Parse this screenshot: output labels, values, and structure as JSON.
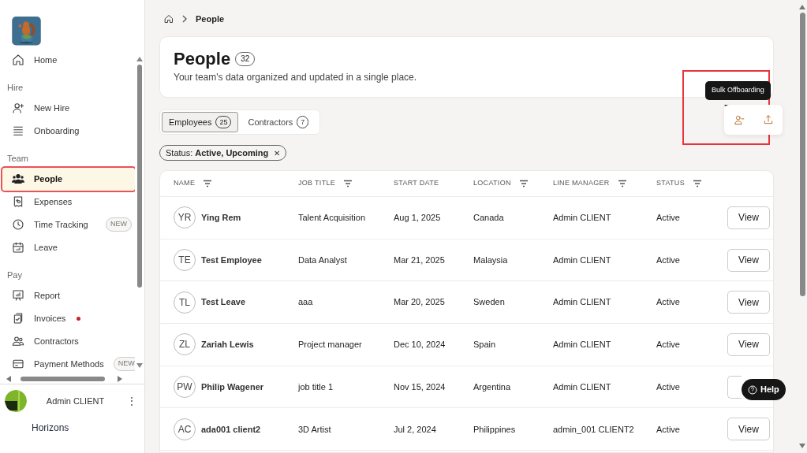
{
  "sidebar": {
    "sections": [
      {
        "items": [
          {
            "label": "Home",
            "selected": false,
            "highlighted": false
          }
        ]
      },
      {
        "title": "Hire",
        "items": [
          {
            "label": "New Hire",
            "selected": false,
            "highlighted": false
          },
          {
            "label": "Onboarding",
            "selected": false,
            "highlighted": false
          }
        ]
      },
      {
        "title": "Team",
        "items": [
          {
            "label": "People",
            "selected": true,
            "highlighted": true
          },
          {
            "label": "Expenses",
            "selected": false,
            "highlighted": false
          },
          {
            "label": "Time Tracking",
            "badge": "NEW",
            "selected": false,
            "highlighted": false
          },
          {
            "label": "Leave",
            "selected": false,
            "highlighted": false
          }
        ]
      },
      {
        "title": "Pay",
        "items": [
          {
            "label": "Report",
            "selected": false,
            "highlighted": false
          },
          {
            "label": "Invoices",
            "notification": true,
            "selected": false,
            "highlighted": false
          },
          {
            "label": "Contractors",
            "selected": false,
            "highlighted": false
          },
          {
            "label": "Payment Methods",
            "badge": "NEW",
            "selected": false,
            "highlighted": false
          }
        ]
      }
    ],
    "user": {
      "name": "Admin CLIENT",
      "menu": "⋮"
    },
    "company": "Horizons"
  },
  "breadcrumb": {
    "current": "People"
  },
  "header": {
    "title": "People",
    "count": "32",
    "subtitle": "Your team's data organized and updated in a single place."
  },
  "actions": {
    "tooltip": "Bulk Offboarding",
    "highlighted": true
  },
  "tabs": [
    {
      "label": "Employees",
      "count": "25",
      "selected": true
    },
    {
      "label": "Contractors",
      "count": "7",
      "selected": false
    }
  ],
  "filter": {
    "label": "Status:",
    "value": "Active, Upcoming",
    "close": "✕"
  },
  "table": {
    "columns": [
      {
        "label": "NAME",
        "filter": true
      },
      {
        "label": "JOB TITLE",
        "filter": true
      },
      {
        "label": "START DATE",
        "filter": false
      },
      {
        "label": "LOCATION",
        "filter": true
      },
      {
        "label": "LINE MANAGER",
        "filter": true
      },
      {
        "label": "STATUS",
        "filter": true
      }
    ],
    "rows": [
      {
        "initials": "YR",
        "name": "Ying Rem",
        "job": "Talent Acquisition",
        "start": "Aug 1, 2025",
        "location": "Canada",
        "manager": "Admin CLIENT",
        "status": "Active",
        "action": "View"
      },
      {
        "initials": "TE",
        "name": "Test Employee",
        "job": "Data Analyst",
        "start": "Mar 21, 2025",
        "location": "Malaysia",
        "manager": "Admin CLIENT",
        "status": "Active",
        "action": "View"
      },
      {
        "initials": "TL",
        "name": "Test Leave",
        "job": "aaa",
        "start": "Mar 20, 2025",
        "location": "Sweden",
        "manager": "Admin CLIENT",
        "status": "Active",
        "action": "View"
      },
      {
        "initials": "ZL",
        "name": "Zariah Lewis",
        "job": "Project manager",
        "start": "Dec 10, 2024",
        "location": "Spain",
        "manager": "Admin CLIENT",
        "status": "Active",
        "action": "View"
      },
      {
        "initials": "PW",
        "name": "Philip Wagener",
        "job": "job title 1",
        "start": "Nov 15, 2024",
        "location": "Argentina",
        "manager": "Admin CLIENT",
        "status": "Active"
      },
      {
        "initials": "AC",
        "name": "ada001 client2",
        "job": "3D Artist",
        "start": "Jul 2, 2024",
        "location": "Philippines",
        "manager": "admin_001 CLIENT2",
        "status": "Active",
        "action": "View"
      }
    ]
  },
  "help": {
    "label": "Help"
  }
}
